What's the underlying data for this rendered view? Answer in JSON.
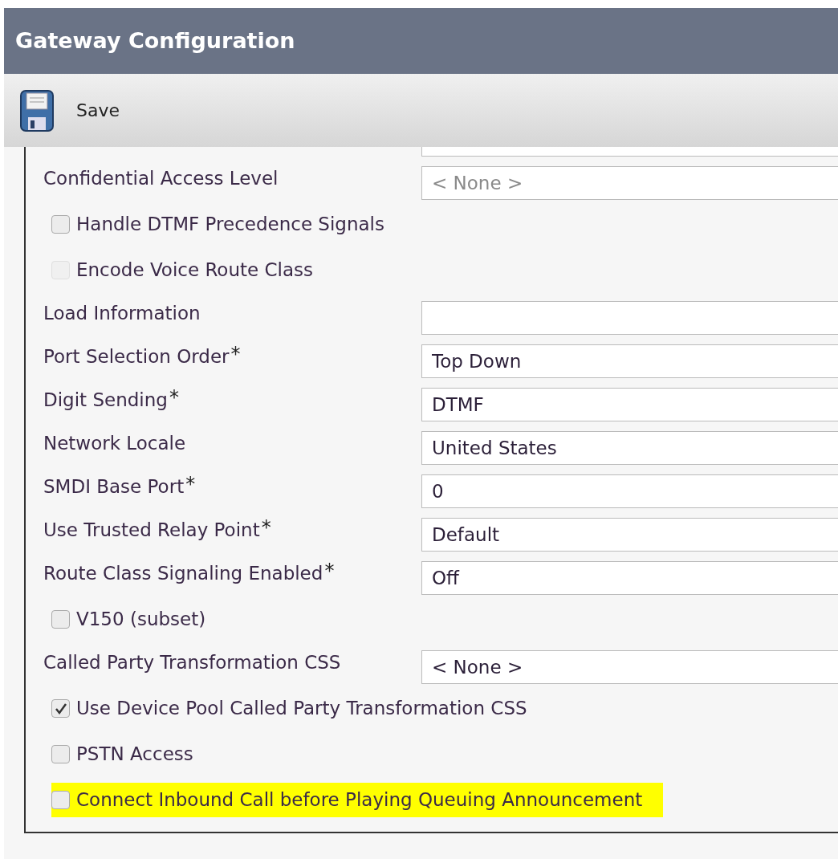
{
  "window": {
    "title": "Gateway Configuration"
  },
  "toolbar": {
    "buttons": [
      {
        "label": "Save"
      }
    ]
  },
  "form": {
    "items": [
      {
        "kind": "field",
        "label": "Confidential Access Level",
        "placeholder": "< None >"
      },
      {
        "kind": "checkbox",
        "label": "Handle DTMF Precedence Signals",
        "checked": false,
        "disabled": false,
        "highlighted": false
      },
      {
        "kind": "checkbox",
        "label": "Encode Voice Route Class",
        "checked": false,
        "disabled": true,
        "highlighted": false
      },
      {
        "kind": "field",
        "label": "Load Information"
      },
      {
        "kind": "field",
        "label": "Port Selection Order",
        "required_mark": "*",
        "value": "Top Down"
      },
      {
        "kind": "field",
        "label": "Digit Sending",
        "required_mark": "*",
        "value": "DTMF"
      },
      {
        "kind": "field",
        "label": "Network Locale",
        "value": "United States"
      },
      {
        "kind": "field",
        "label": "SMDI Base Port",
        "required_mark": "*",
        "value": "0"
      },
      {
        "kind": "field",
        "label": "Use Trusted Relay Point",
        "required_mark": "*",
        "value": "Default"
      },
      {
        "kind": "field",
        "label": "Route Class Signaling Enabled",
        "required_mark": "*",
        "value": "Off"
      },
      {
        "kind": "checkbox",
        "label": "V150 (subset)",
        "checked": false,
        "disabled": false,
        "highlighted": false
      },
      {
        "kind": "field",
        "label": "Called Party Transformation CSS",
        "value": "< None >"
      },
      {
        "kind": "checkbox",
        "label": "Use Device Pool Called Party Transformation CSS",
        "checked": true,
        "disabled": false,
        "highlighted": false
      },
      {
        "kind": "checkbox",
        "label": "PSTN Access",
        "checked": false,
        "disabled": false,
        "highlighted": false
      },
      {
        "kind": "checkbox",
        "label": "Connect Inbound Call before Playing Queuing Announcement",
        "checked": false,
        "disabled": false,
        "highlighted": true
      }
    ]
  }
}
